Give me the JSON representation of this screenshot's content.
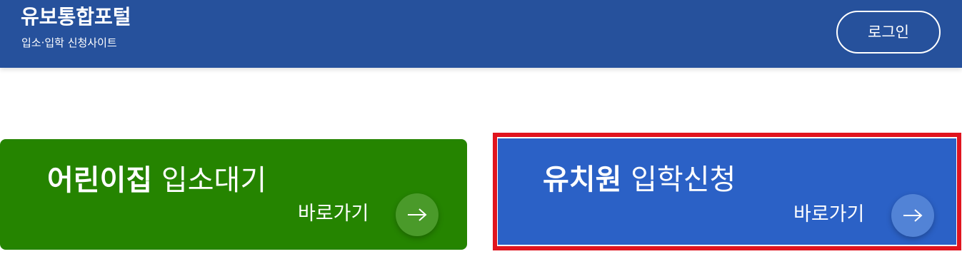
{
  "header": {
    "title": "유보통합포털",
    "subtitle": "입소·입학 신청사이트",
    "login_label": "로그인"
  },
  "cards": [
    {
      "strong": "어린이집",
      "light": "입소대기",
      "goto_label": "바로가기",
      "icon": "arrow-right-icon",
      "color": "#258400"
    },
    {
      "strong": "유치원",
      "light": "입학신청",
      "goto_label": "바로가기",
      "icon": "arrow-right-icon",
      "color": "#2b61c6",
      "highlight_color": "#e0141e"
    }
  ],
  "colors": {
    "header_bg": "#26519c"
  }
}
